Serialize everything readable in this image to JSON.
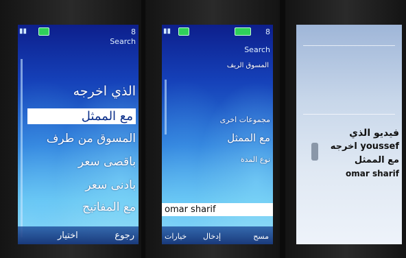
{
  "screen1": {
    "status_number": "8",
    "title": "Search",
    "items": [
      "الذي اخرجه",
      "مع الممثل",
      "المسوق من طرف",
      "باقصى سعر",
      "بادنى سعر",
      "مع المفاتيح"
    ],
    "selected_index": 1,
    "softkey_left": "اختيار",
    "softkey_right": "رجوع"
  },
  "screen2": {
    "status_number": "8",
    "title": "Search",
    "subtitle": "المسوق الريف",
    "items": [
      "مجموعات اخرى",
      "مع الممثل",
      "نوع المدة"
    ],
    "input_text": "omar sharif",
    "softkeys": [
      "خيارات",
      "إدخال",
      "مسح"
    ]
  },
  "screen3": {
    "line1": "فيديو الذي",
    "line2": "اخرجه youssef",
    "line3": "مع الممثل",
    "line4": "omar sharif"
  },
  "colors": {
    "selection_bg": "#ffffff",
    "selection_text": "#0b2f8a",
    "screen_blue_top": "#0d1f8c",
    "screen_blue_bottom": "#9fe0f5",
    "battery_green": "#2fd05a"
  }
}
